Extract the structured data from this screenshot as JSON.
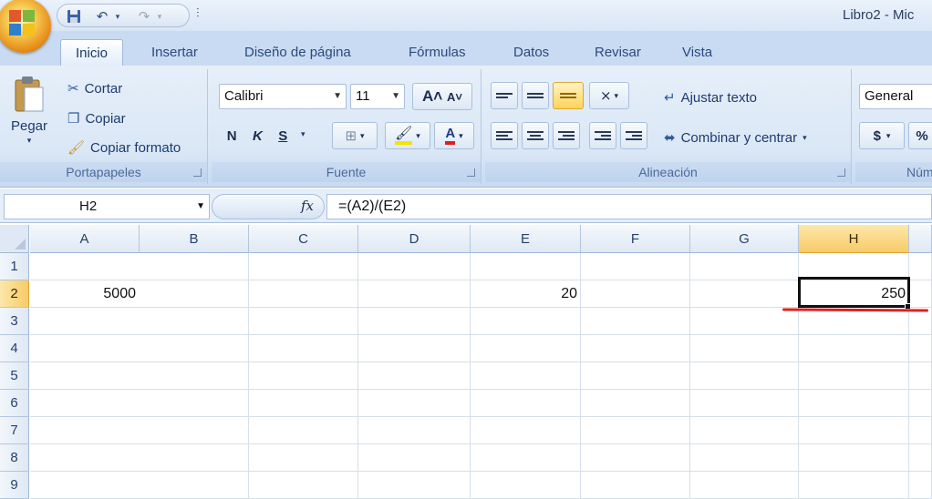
{
  "window": {
    "title": "Libro2 - Mic"
  },
  "quick_access": {
    "save_icon": "save-icon",
    "undo_icon": "undo-icon",
    "redo_icon": "redo-icon",
    "customize_icon": "customize-qat-icon"
  },
  "tabs": [
    {
      "label": "Inicio",
      "active": true
    },
    {
      "label": "Insertar",
      "active": false
    },
    {
      "label": "Diseño de página",
      "active": false
    },
    {
      "label": "Fórmulas",
      "active": false
    },
    {
      "label": "Datos",
      "active": false
    },
    {
      "label": "Revisar",
      "active": false
    },
    {
      "label": "Vista",
      "active": false
    }
  ],
  "ribbon": {
    "clipboard": {
      "label": "Portapapeles",
      "paste": "Pegar",
      "cut": "Cortar",
      "copy": "Copiar",
      "format_painter": "Copiar formato"
    },
    "font": {
      "label": "Fuente",
      "font_name": "Calibri",
      "font_size": "11",
      "bold": "N",
      "italic": "K",
      "underline": "S"
    },
    "alignment": {
      "label": "Alineación",
      "wrap_text": "Ajustar texto",
      "merge_center": "Combinar y centrar"
    },
    "number": {
      "label": "Núm",
      "format": "General",
      "currency": "$",
      "percent": "%"
    }
  },
  "formula_bar": {
    "name_box": "H2",
    "fx": "fx",
    "formula": "=(A2)/(E2)"
  },
  "sheet": {
    "columns": [
      "A",
      "B",
      "C",
      "D",
      "E",
      "F",
      "G",
      "H"
    ],
    "rows": [
      "1",
      "2",
      "3",
      "4",
      "5",
      "6",
      "7",
      "8",
      "9"
    ],
    "selected_column": "H",
    "selected_row": "2",
    "active_cell": "H2",
    "cells": {
      "A2": "5000",
      "E2": "20",
      "H2": "250"
    }
  },
  "colors": {
    "ribbon_bg": "#dae7f6",
    "selected_header": "#f8cb67",
    "annotation_underline": "#e02020"
  }
}
